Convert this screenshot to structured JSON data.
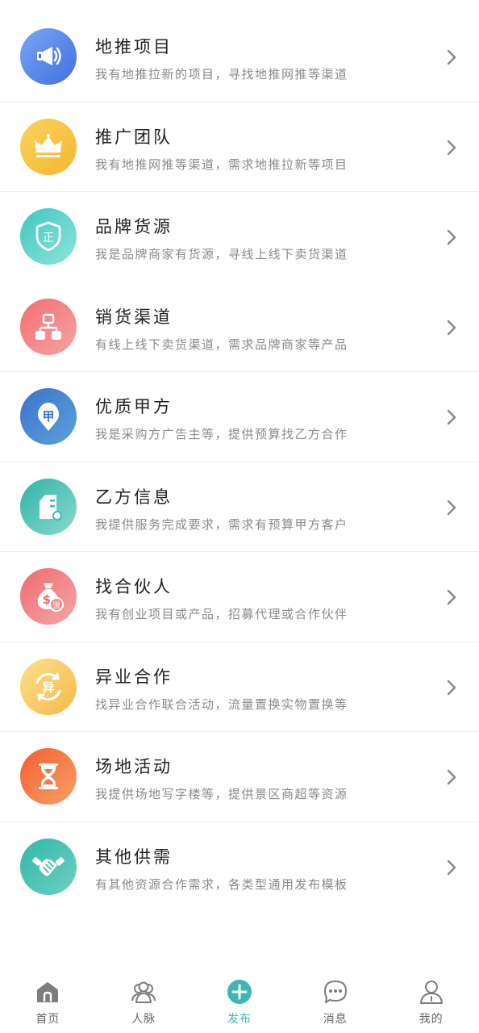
{
  "items": [
    {
      "title": "地推项目",
      "desc": "我有地推拉新的项目，寻找地推网推等渠道",
      "icon": "megaphone-icon"
    },
    {
      "title": "推广团队",
      "desc": "我有地推网推等渠道，需求地推拉新等项目",
      "icon": "crown-icon"
    },
    {
      "title": "品牌货源",
      "desc": "我是品牌商家有货源，寻线上线下卖货渠道",
      "icon": "shield-icon"
    },
    {
      "title": "销货渠道",
      "desc": "有线上线下卖货渠道，需求品牌商家等产品",
      "icon": "hierarchy-icon"
    },
    {
      "title": "优质甲方",
      "desc": "我是采购方广告主等，提供预算找乙方合作",
      "icon": "location-pin-icon"
    },
    {
      "title": "乙方信息",
      "desc": "我提供服务完成要求，需求有预算甲方客户",
      "icon": "document-icon"
    },
    {
      "title": "找合伙人",
      "desc": "我有创业项目或产品，招募代理或合作伙伴",
      "icon": "money-bag-icon"
    },
    {
      "title": "异业合作",
      "desc": "找异业合作联合活动，流量置换实物置换等",
      "icon": "exchange-icon"
    },
    {
      "title": "场地活动",
      "desc": "我提供场地写字楼等，提供景区商超等资源",
      "icon": "hourglass-icon"
    },
    {
      "title": "其他供需",
      "desc": "有其他资源合作需求，各类型通用发布模板",
      "icon": "handshake-icon"
    }
  ],
  "icon_text": {
    "shield": "正",
    "pin": "甲",
    "exchange": "异",
    "bag": "盟"
  },
  "tabs": [
    {
      "label": "首页",
      "icon": "home-icon"
    },
    {
      "label": "人脉",
      "icon": "contacts-icon"
    },
    {
      "label": "发布",
      "icon": "plus-icon"
    },
    {
      "label": "消息",
      "icon": "chat-icon"
    },
    {
      "label": "我的",
      "icon": "profile-icon"
    }
  ],
  "active_tab": "发布",
  "colors": {
    "accent": "#3cb8b0",
    "text": "#222222",
    "subtext": "#8a8a8a"
  }
}
